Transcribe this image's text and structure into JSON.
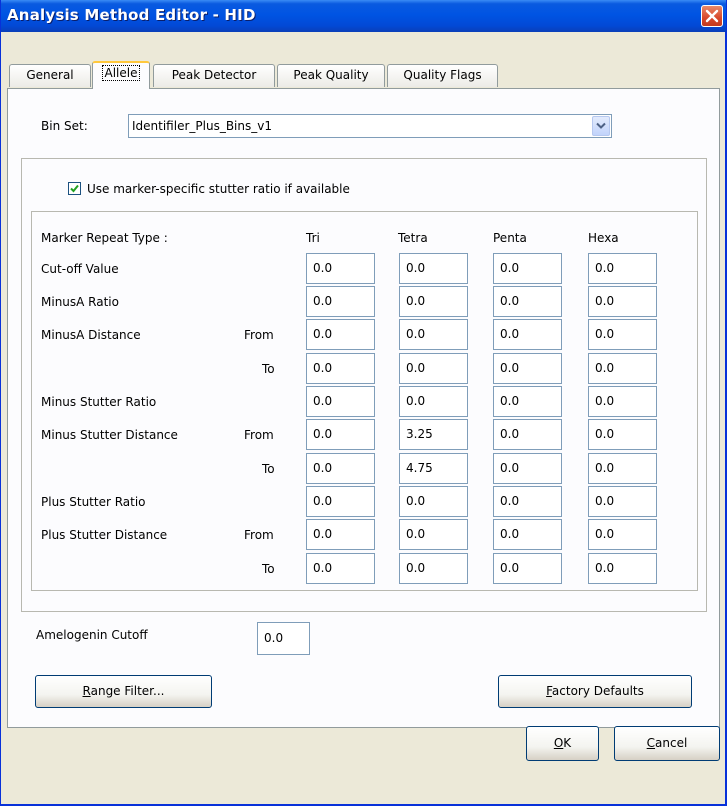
{
  "window": {
    "title": "Analysis Method Editor - HID"
  },
  "tabs": [
    {
      "label": "General",
      "active": false
    },
    {
      "label": "Allele",
      "active": true
    },
    {
      "label": "Peak Detector",
      "active": false
    },
    {
      "label": "Peak Quality",
      "active": false
    },
    {
      "label": "Quality Flags",
      "active": false
    }
  ],
  "bin_set": {
    "label": "Bin Set:",
    "value": "Identifiler_Plus_Bins_v1"
  },
  "stutter_checkbox": {
    "label": "Use marker-specific stutter ratio if available",
    "checked": true
  },
  "table": {
    "header_label": "Marker Repeat Type :",
    "columns": [
      "Tri",
      "Tetra",
      "Penta",
      "Hexa"
    ],
    "rows": [
      {
        "label": "Cut-off Value",
        "sub": "",
        "values": [
          "0.0",
          "0.0",
          "0.0",
          "0.0"
        ]
      },
      {
        "label": "MinusA Ratio",
        "sub": "",
        "values": [
          "0.0",
          "0.0",
          "0.0",
          "0.0"
        ]
      },
      {
        "label": "MinusA Distance",
        "sub": "From",
        "values": [
          "0.0",
          "0.0",
          "0.0",
          "0.0"
        ]
      },
      {
        "label": "",
        "sub": "To",
        "values": [
          "0.0",
          "0.0",
          "0.0",
          "0.0"
        ]
      },
      {
        "label": "Minus Stutter Ratio",
        "sub": "",
        "values": [
          "0.0",
          "0.0",
          "0.0",
          "0.0"
        ]
      },
      {
        "label": "Minus Stutter Distance",
        "sub": "From",
        "values": [
          "0.0",
          "3.25",
          "0.0",
          "0.0"
        ]
      },
      {
        "label": "",
        "sub": "To",
        "values": [
          "0.0",
          "4.75",
          "0.0",
          "0.0"
        ]
      },
      {
        "label": "Plus Stutter Ratio",
        "sub": "",
        "values": [
          "0.0",
          "0.0",
          "0.0",
          "0.0"
        ]
      },
      {
        "label": "Plus Stutter Distance",
        "sub": "From",
        "values": [
          "0.0",
          "0.0",
          "0.0",
          "0.0"
        ]
      },
      {
        "label": "",
        "sub": "To",
        "values": [
          "0.0",
          "0.0",
          "0.0",
          "0.0"
        ]
      }
    ]
  },
  "amelogenin": {
    "label": "Amelogenin Cutoff",
    "value": "0.0"
  },
  "buttons": {
    "range_filter": {
      "mnemonic": "R",
      "rest": "ange Filter..."
    },
    "factory_defaults": {
      "mnemonic": "F",
      "rest": "actory Defaults"
    },
    "ok": {
      "mnemonic": "O",
      "rest": "K"
    },
    "cancel": {
      "mnemonic": "C",
      "rest": "ancel"
    }
  }
}
